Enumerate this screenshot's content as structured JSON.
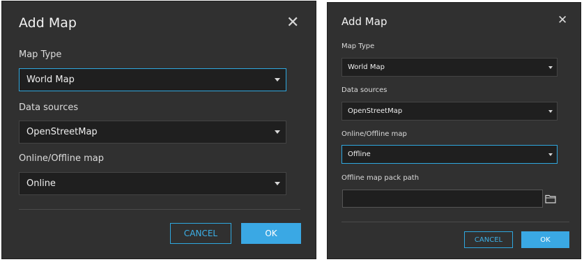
{
  "dialog_left": {
    "title": "Add Map",
    "close_glyph": "✕",
    "map_type": {
      "label": "Map Type",
      "value": "World Map"
    },
    "data_sources": {
      "label": "Data sources",
      "value": "OpenStreetMap"
    },
    "online_offline": {
      "label": "Online/Offline map",
      "value": "Online"
    },
    "cancel_label": "CANCEL",
    "ok_label": "OK"
  },
  "dialog_right": {
    "title": "Add Map",
    "close_glyph": "✕",
    "map_type": {
      "label": "Map Type",
      "value": "World Map"
    },
    "data_sources": {
      "label": "Data sources",
      "value": "OpenStreetMap"
    },
    "online_offline": {
      "label": "Online/Offline map",
      "value": "Offline"
    },
    "offline_path": {
      "label": "Offline map pack path",
      "value": "",
      "placeholder": ""
    },
    "cancel_label": "CANCEL",
    "ok_label": "OK"
  },
  "colors": {
    "dialog_bg": "#303030",
    "field_bg": "#1f1f1f",
    "accent": "#3aa8e4",
    "text": "#e0e0e0"
  },
  "icons": {
    "close": "close-icon",
    "dropdown": "chevron-down-icon",
    "folder": "folder-icon"
  }
}
